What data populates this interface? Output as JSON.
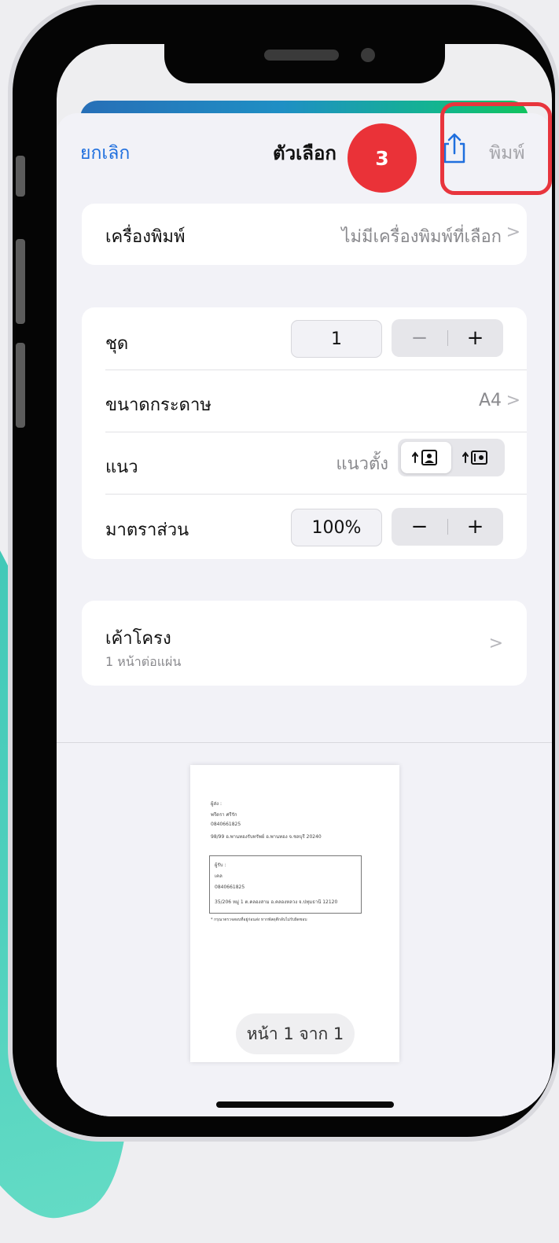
{
  "nav": {
    "cancel": "ยกเลิก",
    "title": "ตัวเลือก",
    "step_badge": "3",
    "print": "พิมพ์"
  },
  "printer": {
    "label": "เครื่องพิมพ์",
    "value": "ไม่มีเครื่องพิมพ์ที่เลือก",
    "chevron": ">"
  },
  "settings": {
    "copies_label": "ชุด",
    "copies_value": "1",
    "paper_label": "ขนาดกระดาษ",
    "paper_value": "A4",
    "orientation_label": "แนว",
    "orientation_value": "แนวตั้ง",
    "scale_label": "มาตราส่วน",
    "scale_value": "100%",
    "minus": "−",
    "plus": "+",
    "chevron": ">"
  },
  "layout": {
    "label": "เค้าโครง",
    "sub": "1 หน้าต่อแผ่น",
    "chevron": ">"
  },
  "preview": {
    "sender_label": "ผู้ส่ง :",
    "sender_name": " พรีดรา ศรีรัก",
    "sender_phone": "0840661825",
    "sender_address": "98/99 อ.พานทองรับทรัพย์ อ.พานทอง จ.ชลบุรี 20240",
    "recipient_label": "ผู้รับ :",
    "recipient_name": "เคล",
    "recipient_phone": "0840661825",
    "recipient_address": "35/206 หมู่ 1 ต.คลองสาม อ.คลองหลวง จ.ปทุมธานี 12120",
    "note": "* กรุณาตรวจสอบที่อยู่ก่อนส่ง หากพัสดุตีกลับไม่รับผิดชอบ",
    "page_indicator": "หน้า 1 จาก 1"
  },
  "colors": {
    "accent": "#1f6fde",
    "highlight": "#e8353d",
    "badge": "#ea3238"
  }
}
